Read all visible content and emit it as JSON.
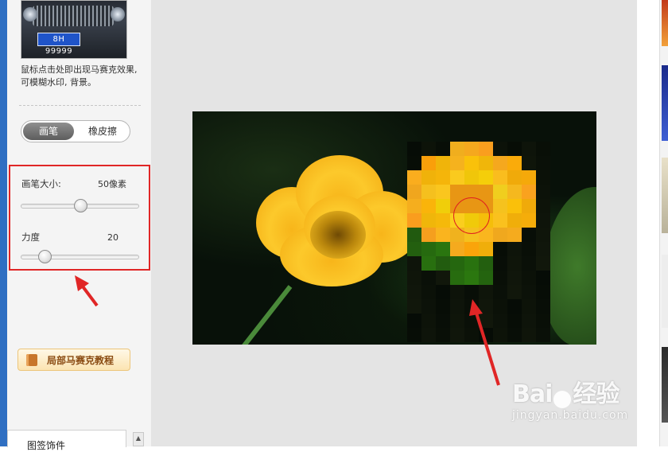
{
  "panel": {
    "thumbnail_plate": "8H 99999",
    "hint_text": "鼠标点击处即出现马赛克效果, 可模糊水印, 背景。",
    "mode_toggle": {
      "brush": "画笔",
      "eraser": "橡皮擦",
      "selected": "画笔"
    },
    "brush_size": {
      "label": "画笔大小:",
      "value_text": "50像素",
      "value": 50,
      "unit": "像素",
      "fraction": 0.5
    },
    "strength": {
      "label": "力度",
      "value_text": "20",
      "value": 20,
      "fraction": 0.2
    },
    "tutorial_button": "局部马赛克教程",
    "bottom_list_item": "图签饰件"
  },
  "colors": {
    "highlight_red": "#e02626",
    "panel_bg": "#f4f4f4",
    "canvas_bg": "#e4e4e4",
    "toggle_active": "#6f6f6f",
    "tutorial_text": "#8a4b12"
  },
  "annotations": {
    "highlight_box": "red-rectangle",
    "arrows": [
      "red-arrow-to-settings",
      "red-arrow-to-mosaic"
    ],
    "brush_cursor": "red-circle"
  },
  "watermark": {
    "brand_big": "Bai",
    "brand_suffix": "经验",
    "url": "jingyan.baidu.com"
  }
}
